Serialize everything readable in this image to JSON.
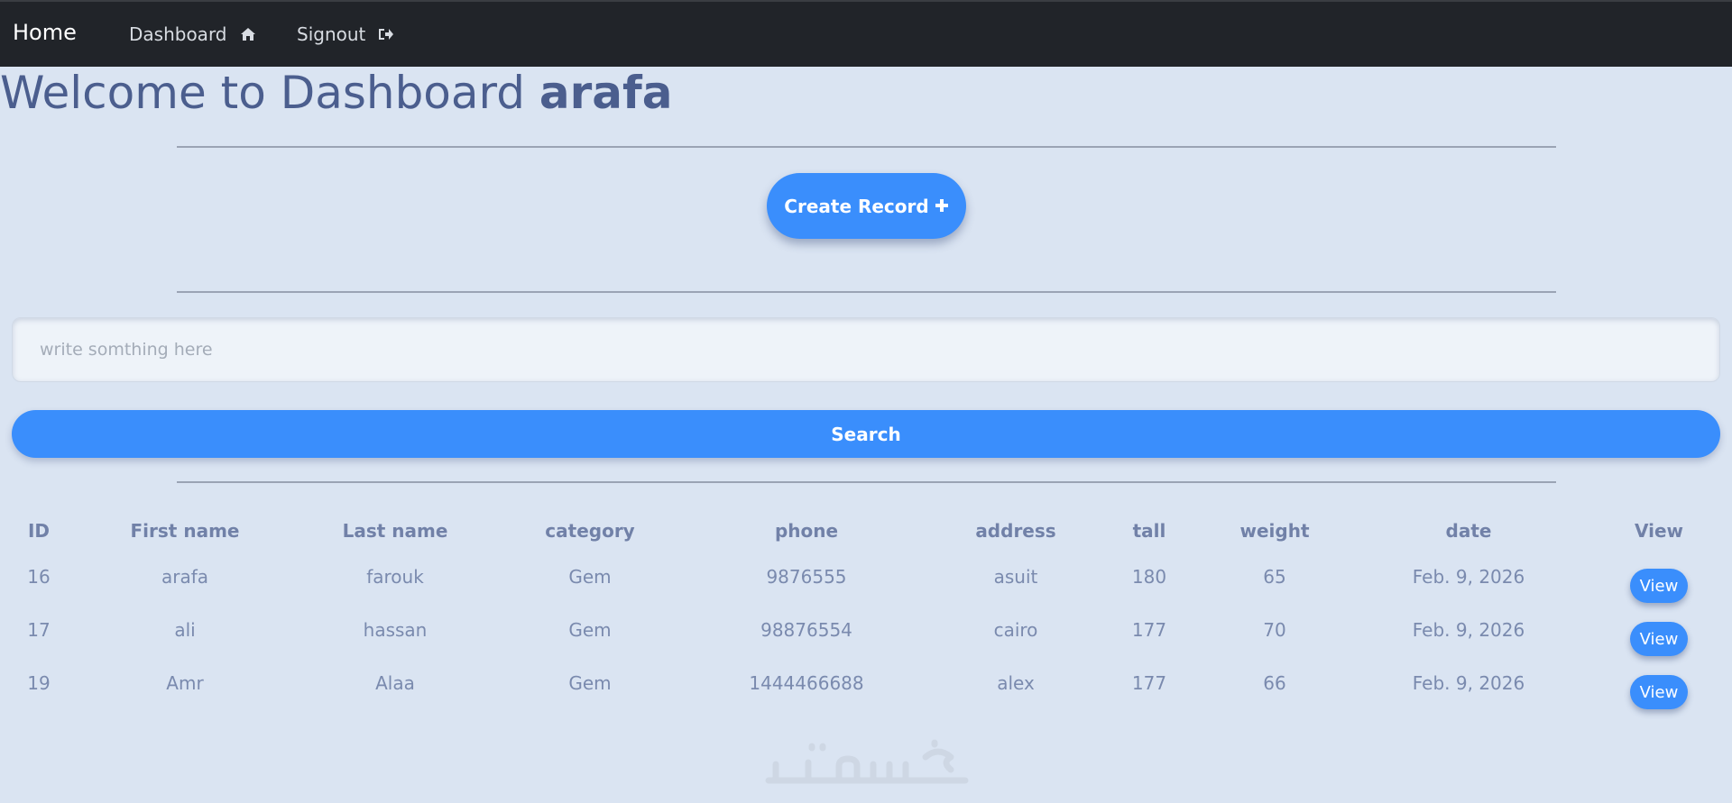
{
  "navbar": {
    "brand": "Home",
    "links": [
      {
        "label": "Dashboard",
        "icon": "home-icon"
      },
      {
        "label": "Signout",
        "icon": "sign-out-icon"
      }
    ]
  },
  "welcome": {
    "prefix": "Welcome to Dashboard",
    "username": "arafa"
  },
  "create_button": {
    "label": "Create Record",
    "icon": "plus-icon"
  },
  "search": {
    "placeholder": "write somthing here",
    "value": "",
    "button_label": "Search"
  },
  "table": {
    "headers": [
      "ID",
      "First name",
      "Last name",
      "category",
      "phone",
      "address",
      "tall",
      "weight",
      "date",
      "View"
    ],
    "rows": [
      {
        "id": "16",
        "first_name": "arafa",
        "last_name": "farouk",
        "category": "Gem",
        "phone": "9876555",
        "address": "asuit",
        "tall": "180",
        "weight": "65",
        "date": "Feb. 9, 2026",
        "action": "View"
      },
      {
        "id": "17",
        "first_name": "ali",
        "last_name": "hassan",
        "category": "Gem",
        "phone": "98876554",
        "address": "cairo",
        "tall": "177",
        "weight": "70",
        "date": "Feb. 9, 2026",
        "action": "View"
      },
      {
        "id": "19",
        "first_name": "Amr",
        "last_name": "Alaa",
        "category": "Gem",
        "phone": "1444466688",
        "address": "alex",
        "tall": "177",
        "weight": "66",
        "date": "Feb. 9, 2026",
        "action": "View"
      }
    ]
  },
  "watermark": {
    "text": "خمسات"
  },
  "colors": {
    "navbar_bg": "#212429",
    "page_bg": "#dae4f2",
    "accent": "#3a8efc",
    "heading": "#4b5e8e",
    "table_text": "#7a8aae"
  }
}
